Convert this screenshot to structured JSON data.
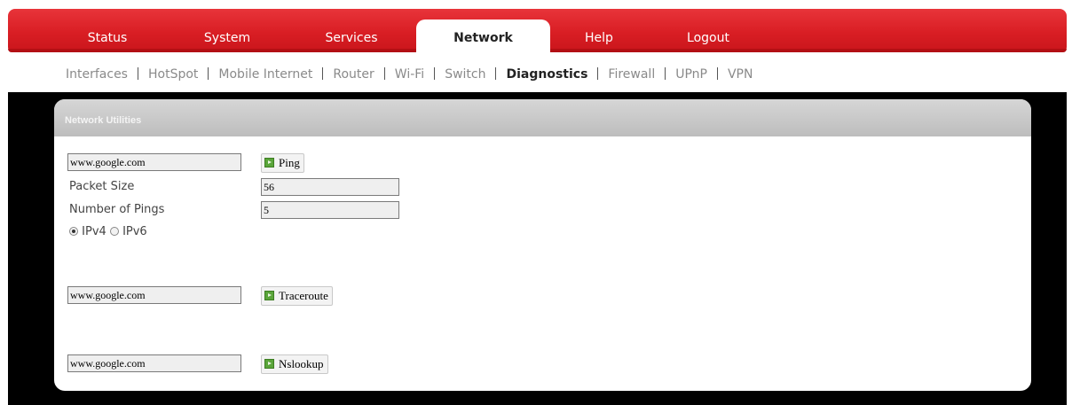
{
  "main_nav": [
    {
      "label": "Status",
      "active": false
    },
    {
      "label": "System",
      "active": false
    },
    {
      "label": "Services",
      "active": false
    },
    {
      "label": "Network",
      "active": true
    },
    {
      "label": "Help",
      "active": false
    },
    {
      "label": "Logout",
      "active": false
    }
  ],
  "sub_nav": [
    {
      "label": "Interfaces",
      "active": false
    },
    {
      "label": "HotSpot",
      "active": false
    },
    {
      "label": "Mobile Internet",
      "active": false
    },
    {
      "label": "Router",
      "active": false
    },
    {
      "label": "Wi-Fi",
      "active": false
    },
    {
      "label": "Switch",
      "active": false
    },
    {
      "label": "Diagnostics",
      "active": true
    },
    {
      "label": "Firewall",
      "active": false
    },
    {
      "label": "UPnP",
      "active": false
    },
    {
      "label": "VPN",
      "active": false
    }
  ],
  "panel": {
    "title": "Network Utilities"
  },
  "ping": {
    "host_value": "www.google.com",
    "button_label": "Ping",
    "packet_size_label": "Packet Size",
    "packet_size_value": "56",
    "num_pings_label": "Number of Pings",
    "num_pings_value": "5",
    "ipv4_label": "IPv4",
    "ipv6_label": "IPv6",
    "selected_protocol": "IPv4"
  },
  "traceroute": {
    "host_value": "www.google.com",
    "button_label": "Traceroute"
  },
  "nslookup": {
    "host_value": "www.google.com",
    "button_label": "Nslookup"
  },
  "colors": {
    "menu_red": "#d91e24",
    "frame_black": "#000000",
    "panel_header_gray": "#c4c4c4",
    "button_icon_green": "#5aa53a"
  }
}
